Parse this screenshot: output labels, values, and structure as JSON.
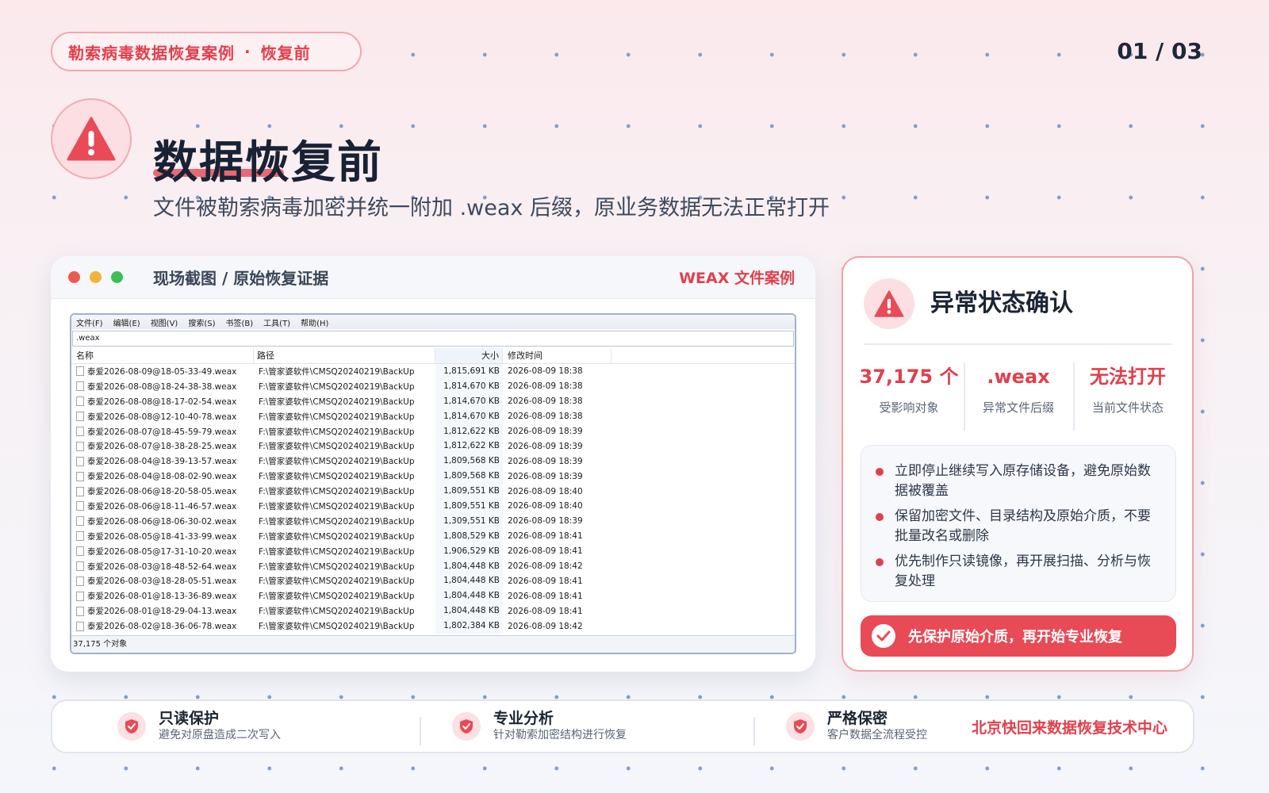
{
  "header": {
    "tag_left": "勒索病毒数据恢复案例",
    "tag_dot": "·",
    "tag_right": "恢复前",
    "page_num": "01 / 03",
    "title": "数据恢复前",
    "subtitle": "文件被勒索病毒加密并统一附加 .weax 后缀，原业务数据无法正常打开"
  },
  "screenshot": {
    "title": "现场截图 / 原始恢复证据",
    "tag": "WEAX 文件案例",
    "menu": [
      "文件(F)",
      "编辑(E)",
      "视图(V)",
      "搜索(S)",
      "书签(B)",
      "工具(T)",
      "帮助(H)"
    ],
    "search_value": ".weax",
    "columns": {
      "name": "名称",
      "path": "路径",
      "size": "大小",
      "mtime": "修改时间"
    },
    "rows": [
      {
        "name": "泰爱2026-08-09@18-05-33-49.weax",
        "path": "F:\\管家婆软件\\CMSQ20240219\\BackUp",
        "size": "1,815,691 KB",
        "mtime": "2026-08-09 18:38"
      },
      {
        "name": "泰爱2026-08-08@18-24-38-38.weax",
        "path": "F:\\管家婆软件\\CMSQ20240219\\BackUp",
        "size": "1,814,670 KB",
        "mtime": "2026-08-09 18:38"
      },
      {
        "name": "泰爱2026-08-08@18-17-02-54.weax",
        "path": "F:\\管家婆软件\\CMSQ20240219\\BackUp",
        "size": "1,814,670 KB",
        "mtime": "2026-08-09 18:38"
      },
      {
        "name": "泰爱2026-08-08@12-10-40-78.weax",
        "path": "F:\\管家婆软件\\CMSQ20240219\\BackUp",
        "size": "1,814,670 KB",
        "mtime": "2026-08-09 18:38"
      },
      {
        "name": "泰爱2026-08-07@18-45-59-79.weax",
        "path": "F:\\管家婆软件\\CMSQ20240219\\BackUp",
        "size": "1,812,622 KB",
        "mtime": "2026-08-09 18:39"
      },
      {
        "name": "泰爱2026-08-07@18-38-28-25.weax",
        "path": "F:\\管家婆软件\\CMSQ20240219\\BackUp",
        "size": "1,812,622 KB",
        "mtime": "2026-08-09 18:39"
      },
      {
        "name": "泰爱2026-08-04@18-39-13-57.weax",
        "path": "F:\\管家婆软件\\CMSQ20240219\\BackUp",
        "size": "1,809,568 KB",
        "mtime": "2026-08-09 18:39"
      },
      {
        "name": "泰爱2026-08-04@18-08-02-90.weax",
        "path": "F:\\管家婆软件\\CMSQ20240219\\BackUp",
        "size": "1,809,568 KB",
        "mtime": "2026-08-09 18:39"
      },
      {
        "name": "泰爱2026-08-06@18-20-58-05.weax",
        "path": "F:\\管家婆软件\\CMSQ20240219\\BackUp",
        "size": "1,809,551 KB",
        "mtime": "2026-08-09 18:40"
      },
      {
        "name": "泰爱2026-08-06@18-11-46-57.weax",
        "path": "F:\\管家婆软件\\CMSQ20240219\\BackUp",
        "size": "1,809,551 KB",
        "mtime": "2026-08-09 18:40"
      },
      {
        "name": "泰爱2026-08-06@18-06-30-02.weax",
        "path": "F:\\管家婆软件\\CMSQ20240219\\BackUp",
        "size": "1,309,551 KB",
        "mtime": "2026-08-09 18:39"
      },
      {
        "name": "泰爱2026-08-05@18-41-33-99.weax",
        "path": "F:\\管家婆软件\\CMSQ20240219\\BackUp",
        "size": "1,808,529 KB",
        "mtime": "2026-08-09 18:41"
      },
      {
        "name": "泰爱2026-08-05@17-31-10-20.weax",
        "path": "F:\\管家婆软件\\CMSQ20240219\\BackUp",
        "size": "1,906,529 KB",
        "mtime": "2026-08-09 18:41"
      },
      {
        "name": "泰爱2026-08-03@18-48-52-64.weax",
        "path": "F:\\管家婆软件\\CMSQ20240219\\BackUp",
        "size": "1,804,448 KB",
        "mtime": "2026-08-09 18:42"
      },
      {
        "name": "泰爱2026-08-03@18-28-05-51.weax",
        "path": "F:\\管家婆软件\\CMSQ20240219\\BackUp",
        "size": "1,804,448 KB",
        "mtime": "2026-08-09 18:41"
      },
      {
        "name": "泰爱2026-08-01@18-13-36-89.weax",
        "path": "F:\\管家婆软件\\CMSQ20240219\\BackUp",
        "size": "1,804,448 KB",
        "mtime": "2026-08-09 18:41"
      },
      {
        "name": "泰爱2026-08-01@18-29-04-13.weax",
        "path": "F:\\管家婆软件\\CMSQ20240219\\BackUp",
        "size": "1,804,448 KB",
        "mtime": "2026-08-09 18:41"
      },
      {
        "name": "泰爱2026-08-02@18-36-06-78.weax",
        "path": "F:\\管家婆软件\\CMSQ20240219\\BackUp",
        "size": "1,802,384 KB",
        "mtime": "2026-08-09 18:42"
      }
    ],
    "status": "37,175 个对象"
  },
  "panel": {
    "title": "异常状态确认",
    "stats": [
      {
        "value": "37,175 个",
        "label": "受影响对象"
      },
      {
        "value": ".weax",
        "label": "异常文件后缀"
      },
      {
        "value": "无法打开",
        "label": "当前文件状态"
      }
    ],
    "advice": [
      "立即停止继续写入原存储设备，避免原始数据被覆盖",
      "保留加密文件、目录结构及原始介质，不要批量改名或删除",
      "优先制作只读镜像，再开展扫描、分析与恢复处理"
    ],
    "cta": "先保护原始介质，再开始专业恢复"
  },
  "footer": {
    "features": [
      {
        "title": "只读保护",
        "desc": "避免对原盘造成二次写入",
        "icon": "shield-icon"
      },
      {
        "title": "专业分析",
        "desc": "针对勒索加密结构进行恢复",
        "icon": "shield-icon"
      },
      {
        "title": "严格保密",
        "desc": "客户数据全流程受控",
        "icon": "shield-icon"
      }
    ],
    "org": "北京快回来数据恢复技术中心"
  },
  "colors": {
    "accent": "#e0404c",
    "accent_soft": "#fbdfe2",
    "text_dark": "#1b2535"
  }
}
